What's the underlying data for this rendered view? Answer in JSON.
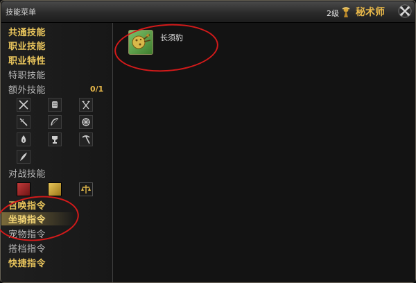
{
  "window": {
    "title": "技能菜单",
    "level": "2级",
    "job_name": "秘术师"
  },
  "sidebar": {
    "categories": [
      {
        "label": "共通技能"
      },
      {
        "label": "职业技能"
      },
      {
        "label": "职业特性"
      },
      {
        "label": "特职技能"
      },
      {
        "label": "额外技能"
      },
      {
        "label": "对战技能"
      },
      {
        "label": "召唤指令"
      },
      {
        "label": "坐骑指令"
      },
      {
        "label": "宠物指令"
      },
      {
        "label": "搭档指令"
      },
      {
        "label": "快捷指令"
      }
    ],
    "extra_count": "0/1",
    "extra_icons": [
      "crossed-swords-icon",
      "scroll-icon",
      "axe-icon",
      "sword-icon",
      "bow-icon",
      "emblem-icon",
      "flame-icon",
      "trophy-icon",
      "pickaxe-icon",
      "quill-icon"
    ],
    "pvp_icons": [
      "red-crest-icon",
      "gold-idol-icon",
      "scales-icon"
    ],
    "selected": "坐骑指令"
  },
  "main": {
    "mount": {
      "name": "长须豹",
      "icon": "mount-icon"
    }
  }
}
